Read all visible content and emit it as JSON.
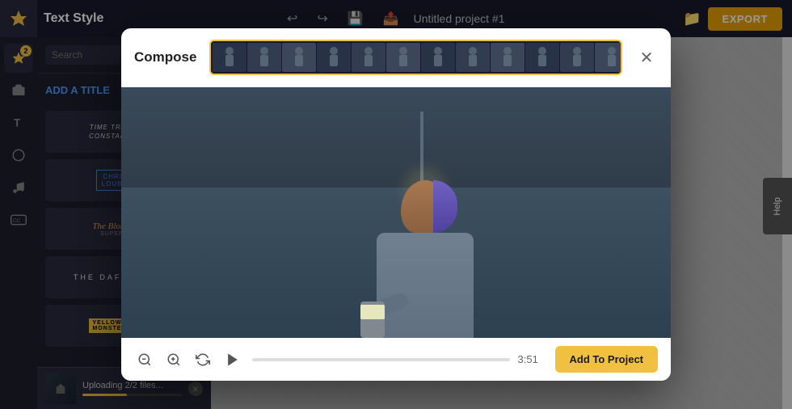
{
  "topbar": {
    "title": "Text Style",
    "project_name": "Untitled project #1",
    "export_label": "EXPORT",
    "undo_icon": "↩",
    "redo_icon": "↪",
    "save_icon": "💾",
    "share_icon": "📤",
    "help_label": "Help"
  },
  "sidebar": {
    "badge_count": "2",
    "icons": [
      "✦",
      "▶",
      "T",
      "◉",
      "♪",
      "CC"
    ]
  },
  "panel": {
    "search_placeholder": "Search",
    "add_title_label": "ADD A TITLE",
    "style_items": [
      {
        "id": "time-travels",
        "text": "TIME TRAVELS TO CONSTANTINOPLE"
      },
      {
        "id": "christian-louboutin",
        "text": "CHRISTIAN LOUBOUTIN"
      },
      {
        "id": "blonde-salad",
        "text": "The Blonde Salad"
      },
      {
        "id": "daft-knight",
        "text": "THE DAFT KNIGHT"
      },
      {
        "id": "yellow-style",
        "text": "YELLOW MONSTER STYLE"
      }
    ]
  },
  "upload": {
    "text": "Uploading 2/2 files...",
    "progress": 45
  },
  "modal": {
    "title": "Compose",
    "close_icon": "✕",
    "play_icon": "▶",
    "zoom_in_icon": "⊕",
    "zoom_out_icon": "⊖",
    "rotate_icon": "↻",
    "time": "3:51",
    "add_to_project_label": "Add To Project",
    "filmstrip_frames": 15
  }
}
